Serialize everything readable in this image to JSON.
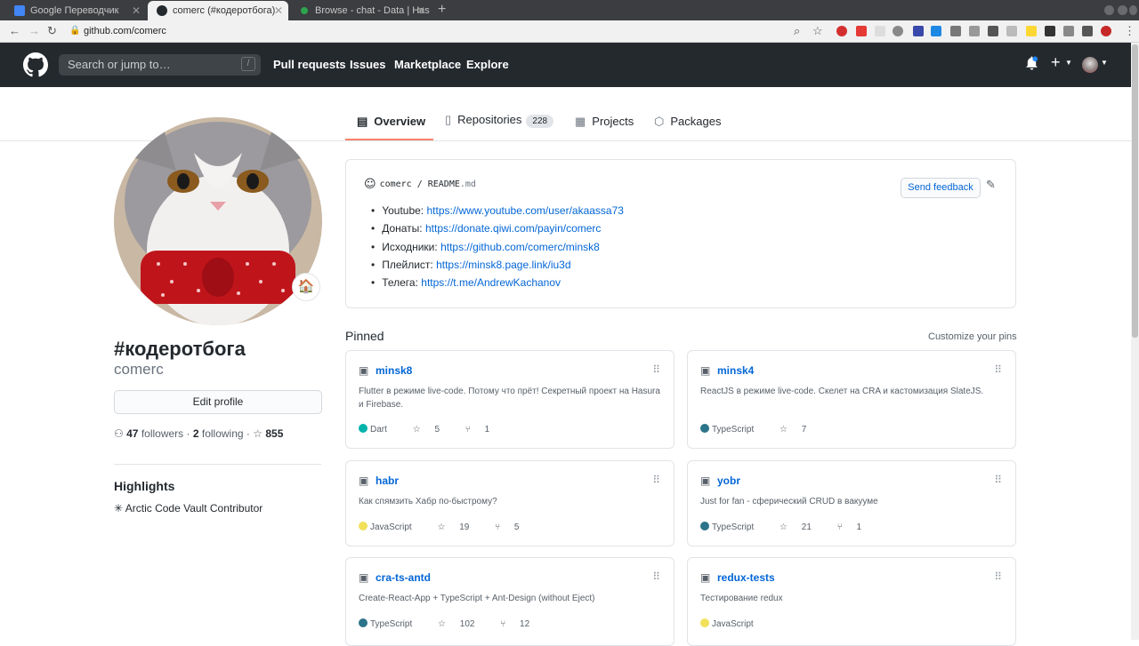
{
  "browser": {
    "tabs": [
      {
        "title": "Google Переводчик",
        "active": false,
        "fav_color": "#4285f4"
      },
      {
        "title": "comerc (#кодеротбога)",
        "active": true,
        "fav_color": "#24292e"
      },
      {
        "title": "Browse - chat - Data | Has",
        "active": false,
        "fav_color": "#2ea44f"
      }
    ],
    "url": "github.com/comerc"
  },
  "header": {
    "search_placeholder": "Search or jump to…",
    "search_key": "/",
    "nav": [
      "Pull requests",
      "Issues",
      "Marketplace",
      "Explore"
    ]
  },
  "profile_tabs": [
    {
      "label": "Overview",
      "icon": "book-icon",
      "active": true
    },
    {
      "label": "Repositories",
      "icon": "repo-icon",
      "count": "228"
    },
    {
      "label": "Projects",
      "icon": "project-icon"
    },
    {
      "label": "Packages",
      "icon": "package-icon"
    }
  ],
  "profile": {
    "name": "#кодеротбога",
    "login": "comerc",
    "status_emoji": "🏠",
    "edit_label": "Edit profile",
    "followers": "47",
    "followers_label": "followers",
    "following": "2",
    "following_label": "following",
    "stars": "855",
    "highlights_title": "Highlights",
    "highlight": "Arctic Code Vault Contributor"
  },
  "readme": {
    "owner": "comerc",
    "file": "README",
    "ext": ".md",
    "feedback": "Send feedback",
    "items": [
      {
        "label": "Youtube:",
        "link": "https://www.youtube.com/user/akaassa73"
      },
      {
        "label": "Донаты:",
        "link": "https://donate.qiwi.com/payin/comerc"
      },
      {
        "label": "Исходники:",
        "link": "https://github.com/comerc/minsk8"
      },
      {
        "label": "Плейлист:",
        "link": "https://minsk8.page.link/iu3d"
      },
      {
        "label": "Телега:",
        "link": "https://t.me/AndrewKachanov"
      }
    ]
  },
  "pinned": {
    "title": "Pinned",
    "customize": "Customize your pins",
    "repos": [
      {
        "name": "minsk8",
        "desc": "Flutter в режиме live-code. Потому что прёт! Секретный проект на Hasura и Firebase.",
        "lang": "Dart",
        "lang_color": "#00b4ab",
        "stars": "5",
        "forks": "1"
      },
      {
        "name": "minsk4",
        "desc": "ReactJS в режиме live-code. Скелет на CRA и кастомизация SlateJS.",
        "lang": "TypeScript",
        "lang_color": "#2b7489",
        "stars": "7",
        "forks": ""
      },
      {
        "name": "habr",
        "desc": "Как спямзить Хабр по-быстрому?",
        "lang": "JavaScript",
        "lang_color": "#f1e05a",
        "stars": "19",
        "forks": "5"
      },
      {
        "name": "yobr",
        "desc": "Just for fan - сферический CRUD в вакууме",
        "lang": "TypeScript",
        "lang_color": "#2b7489",
        "stars": "21",
        "forks": "1"
      },
      {
        "name": "cra-ts-antd",
        "desc": "Create-React-App + TypeScript + Ant-Design (without Eject)",
        "lang": "TypeScript",
        "lang_color": "#2b7489",
        "stars": "102",
        "forks": "12"
      },
      {
        "name": "redux-tests",
        "desc": "Тестирование redux",
        "lang": "JavaScript",
        "lang_color": "#f1e05a",
        "stars": "",
        "forks": ""
      }
    ]
  }
}
